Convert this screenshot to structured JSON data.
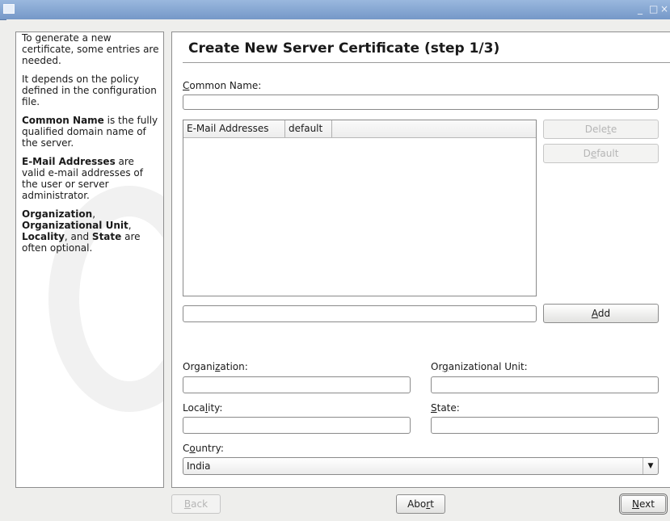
{
  "window": {
    "controls": {
      "minimize": "_",
      "maximize": "□",
      "close": "×"
    }
  },
  "help": {
    "p1": "To generate a new certificate, some entries are needed.",
    "p2": "It depends on the policy defined in the configuration file.",
    "p3_bold": "Common Name",
    "p3_rest": " is the fully qualified domain name of the server.",
    "p4_bold": "E-Mail Addresses",
    "p4_rest": " are valid e-mail addresses of the user or server administrator.",
    "p5_b1": "Organization",
    "p5_t1": ", ",
    "p5_b2": "Organizational Unit",
    "p5_t2": ", ",
    "p5_b3": "Locality",
    "p5_t3": ", and ",
    "p5_b4": "State",
    "p5_t4": " are often optional."
  },
  "form": {
    "title": "Create New Server Certificate (step 1/3)",
    "common_name": {
      "label_mnemonic": "C",
      "label_rest": "ommon Name:",
      "value": ""
    },
    "email_table": {
      "columns": [
        "E-Mail Addresses",
        "default"
      ],
      "rows": []
    },
    "delete_button": {
      "pre": "Dele",
      "mnemonic": "t",
      "post": "e"
    },
    "default_button": {
      "pre": "D",
      "mnemonic": "e",
      "post": "fault"
    },
    "email_input": "",
    "add_button": {
      "mnemonic": "A",
      "post": "dd"
    },
    "organization": {
      "pre": "Organi",
      "mnemonic": "z",
      "post": "ation:",
      "value": ""
    },
    "org_unit": {
      "pre": "Or",
      "mnemonic": "g",
      "post": "anizational Unit:",
      "value": ""
    },
    "locality": {
      "pre": "Loca",
      "mnemonic": "l",
      "post": "ity:",
      "value": ""
    },
    "state": {
      "pre": "",
      "mnemonic": "S",
      "post": "tate:",
      "value": ""
    },
    "country": {
      "pre": "C",
      "mnemonic": "o",
      "post": "untry:",
      "selected": "India"
    }
  },
  "nav": {
    "back": {
      "mnemonic": "B",
      "post": "ack"
    },
    "abort": {
      "pre": "Abo",
      "mnemonic": "r",
      "post": "t"
    },
    "next": {
      "mnemonic": "N",
      "post": "ext"
    }
  }
}
